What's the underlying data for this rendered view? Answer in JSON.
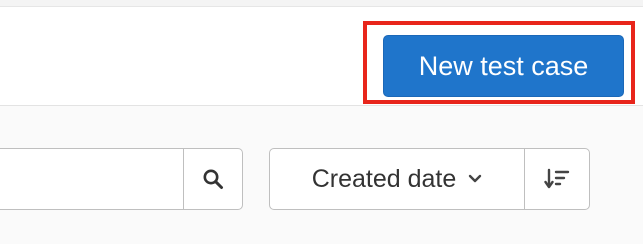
{
  "header": {
    "new_test_case_label": "New test case",
    "highlight_color": "#e8251b",
    "button_color": "#1f75cb"
  },
  "toolbar": {
    "search": {
      "value": "",
      "placeholder": "",
      "icon": "search-icon"
    },
    "sort": {
      "selected": "Created date",
      "dropdown_icon": "chevron-down-icon",
      "direction_icon": "sort-descending-icon"
    }
  }
}
